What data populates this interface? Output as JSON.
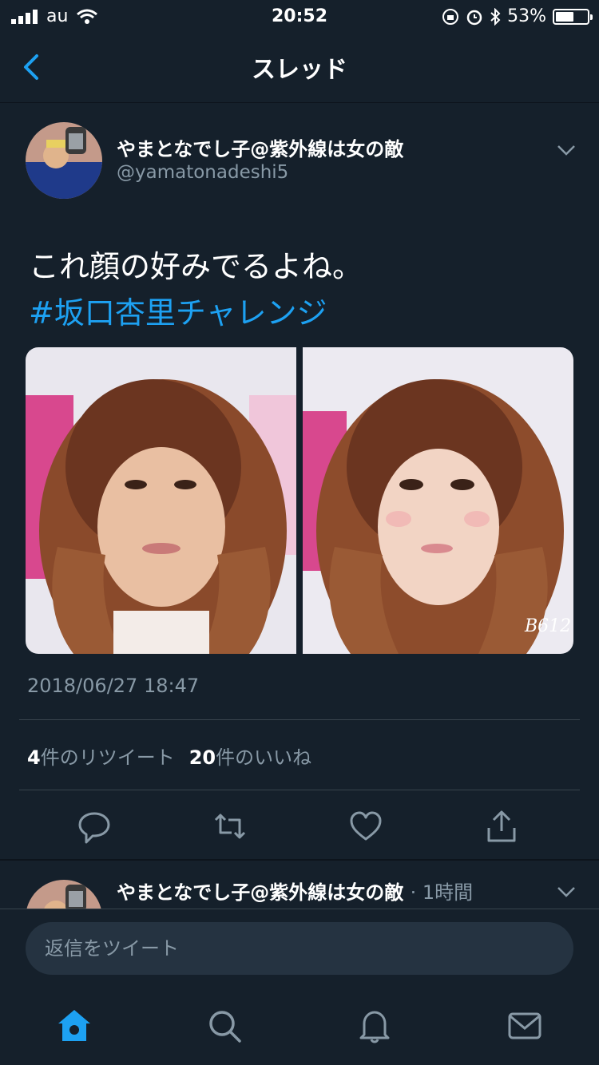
{
  "status": {
    "carrier": "au",
    "time": "20:52",
    "battery": "53%"
  },
  "nav": {
    "title": "スレッド"
  },
  "tweet": {
    "name": "やまとなでし子@紫外線は女の敵",
    "handle": "@yamatonadeshi5",
    "text": "これ顔の好みでるよね。",
    "hashtag": "#坂口杏里チャレンジ",
    "watermark": "B612",
    "timestamp": "2018/06/27 18:47",
    "retweets_count": "4",
    "retweets_label": "件のリツイート",
    "likes_count": "20",
    "likes_label": "件のいいね"
  },
  "reply_preview": {
    "name": "やまとなでし子@紫外線は女の敵",
    "time": "· 1時間"
  },
  "composer": {
    "placeholder": "返信をツイート"
  },
  "colors": {
    "background": "#15202b",
    "accent": "#1da1f2",
    "secondary_text": "#8899a6"
  },
  "icons": {
    "actions": [
      "reply-icon",
      "retweet-icon",
      "like-icon",
      "share-icon"
    ],
    "tabs": [
      "home-icon",
      "search-icon",
      "notifications-icon",
      "messages-icon"
    ]
  }
}
